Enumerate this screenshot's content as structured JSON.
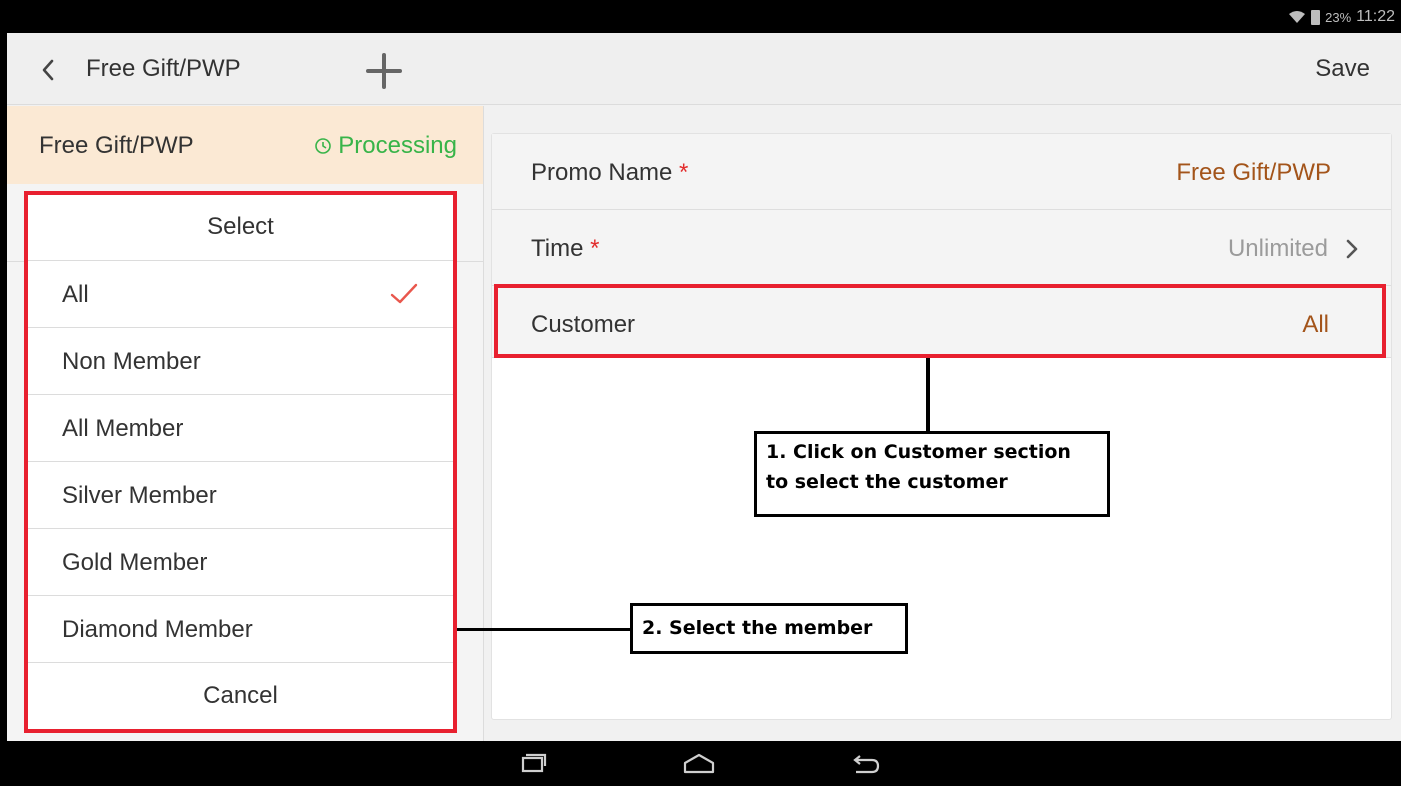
{
  "status_bar": {
    "battery": "23%",
    "time": "11:22"
  },
  "topbar": {
    "title": "Free Gift/PWP",
    "save_label": "Save"
  },
  "promo": {
    "name": "Free Gift/PWP",
    "status": "Processing"
  },
  "picker": {
    "title": "Select",
    "options": [
      {
        "label": "All",
        "selected": true
      },
      {
        "label": "Non Member",
        "selected": false
      },
      {
        "label": "All Member",
        "selected": false
      },
      {
        "label": "Silver Member",
        "selected": false
      },
      {
        "label": "Gold Member",
        "selected": false
      },
      {
        "label": "Diamond Member",
        "selected": false
      }
    ],
    "cancel_label": "Cancel"
  },
  "form": {
    "promo_name": {
      "label": "Promo Name",
      "required_mark": "*",
      "value": "Free Gift/PWP"
    },
    "time": {
      "label": "Time",
      "required_mark": "*",
      "value": "Unlimited"
    },
    "customer": {
      "label": "Customer",
      "value": "All"
    }
  },
  "annotations": {
    "step1_line1": "1. Click on Customer section",
    "step1_line2": "to select the customer",
    "step2": "2. Select the member"
  },
  "colors": {
    "accent_value": "#a3541a",
    "status_green": "#38b449",
    "highlight_red": "#e8202f",
    "header_tint": "#fbe9d4",
    "check_red": "#e9574d"
  },
  "icons": [
    "wifi-icon",
    "battery-icon",
    "back-chevron-icon",
    "plus-icon",
    "clock-icon",
    "check-icon",
    "chevron-right-icon",
    "recent-apps-icon",
    "home-icon",
    "back-icon"
  ]
}
